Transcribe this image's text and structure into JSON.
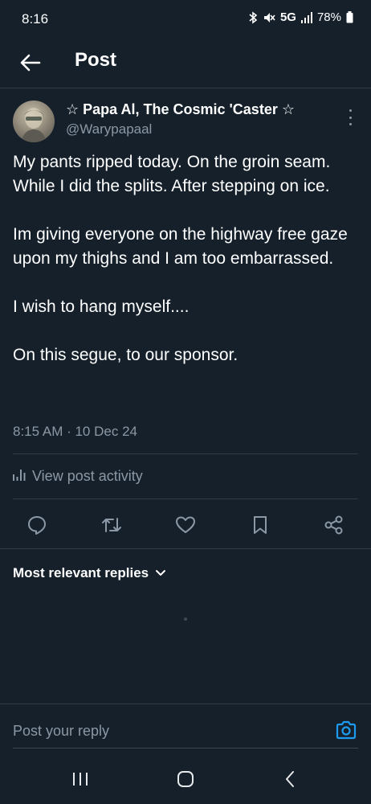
{
  "status_bar": {
    "time": "8:16",
    "network": "5G",
    "battery": "78%"
  },
  "header": {
    "title": "Post"
  },
  "post": {
    "display_name": "☆ Papa Al, The Cosmic 'Caster ☆",
    "handle": "@Warypapaal",
    "paragraphs": [
      "My pants ripped today. On the groin seam. While I did the splits. After stepping on ice.",
      "Im giving everyone on the highway free gaze upon my thighs and I am too embarrassed.",
      "I wish to hang myself....",
      "On this segue, to our sponsor."
    ],
    "timestamp": "8:15 AM · 10 Dec 24"
  },
  "activity": {
    "label": "View post activity"
  },
  "replies": {
    "sort_label": "Most relevant replies"
  },
  "reply_box": {
    "placeholder": "Post your reply"
  },
  "colors": {
    "background": "#15202b",
    "accent": "#1d9bf0",
    "muted_text": "#8b98a5",
    "divider": "#2f3b47"
  }
}
